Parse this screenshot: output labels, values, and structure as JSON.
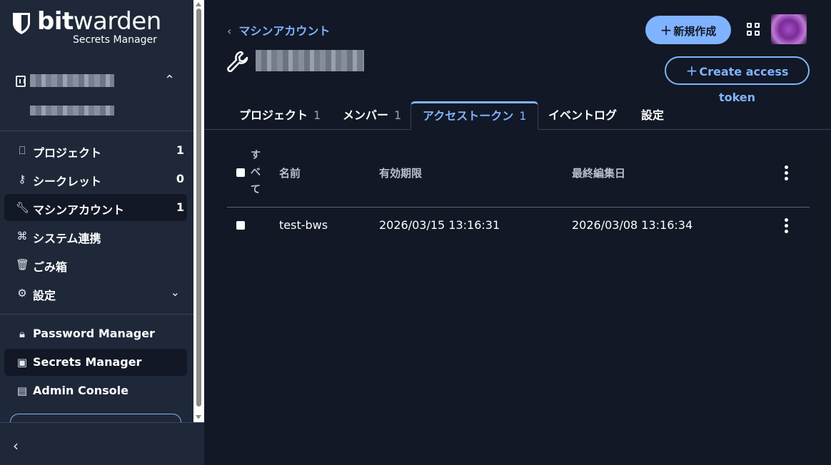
{
  "brand": {
    "name_bold": "bit",
    "name_light": "warden",
    "product": "Secrets Manager"
  },
  "nav": [
    {
      "label": "プロジェクト",
      "count": "1",
      "icon": "projects-icon"
    },
    {
      "label": "シークレット",
      "count": "0",
      "icon": "key-icon"
    },
    {
      "label": "マシンアカウント",
      "count": "1",
      "icon": "wrench-icon"
    },
    {
      "label": "システム連携",
      "icon": "integrations-icon"
    },
    {
      "label": "ごみ箱",
      "icon": "trash-icon"
    },
    {
      "label": "設定",
      "icon": "gear-icon"
    }
  ],
  "products": [
    {
      "label": "Password Manager",
      "icon": "lock-icon"
    },
    {
      "label": "Secrets Manager",
      "icon": "terminal-icon"
    },
    {
      "label": "Admin Console",
      "icon": "building-icon"
    }
  ],
  "header": {
    "back_label": "マシンアカウント",
    "new_label": "新規作成",
    "token_label": "Create access token"
  },
  "tabs": [
    {
      "label": "プロジェクト",
      "count": "1"
    },
    {
      "label": "メンバー",
      "count": "1"
    },
    {
      "label": "アクセストークン",
      "count": "1"
    },
    {
      "label": "イベントログ"
    },
    {
      "label": "設定"
    }
  ],
  "table": {
    "select_all": [
      "す",
      "べ",
      "て"
    ],
    "columns": [
      "名前",
      "有効期限",
      "最終編集日"
    ],
    "rows": [
      {
        "name": "test-bws",
        "expires": "2026/03/15 13:16:31",
        "edited": "2026/03/08 13:16:34"
      }
    ]
  },
  "colors": {
    "accent": "#80b3ff",
    "sidebar": "#1e2838",
    "background": "#121826"
  }
}
